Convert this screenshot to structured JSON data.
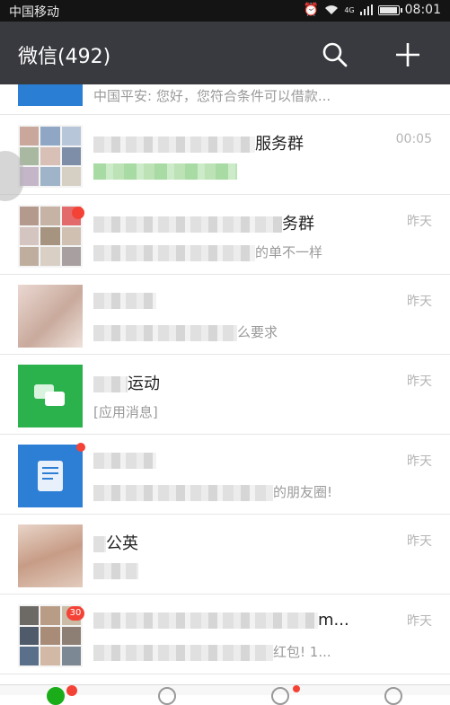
{
  "status_bar": {
    "carrier": "中国移动",
    "network": "4G",
    "time": "08:01"
  },
  "header": {
    "title": "微信(492)"
  },
  "partial_item": {
    "preview": "中国平安: 您好，您符合条件可以借款..."
  },
  "chats": [
    {
      "name_visible": "服务群",
      "preview_visible": "",
      "time": "00:05"
    },
    {
      "name_visible": "务群",
      "preview_visible": "的单不一样",
      "time": "昨天"
    },
    {
      "name_visible": "",
      "preview_visible": "么要求",
      "time": "昨天"
    },
    {
      "name_visible": "运动",
      "preview_visible": "[应用消息]",
      "time": "昨天"
    },
    {
      "name_visible": "",
      "preview_visible": "的朋友圈!",
      "time": "昨天"
    },
    {
      "name_visible": "公英",
      "preview_visible": "",
      "time": "昨天"
    },
    {
      "name_visible": "m...",
      "preview_visible": "红包! 1...",
      "time": "昨天",
      "badge": "30"
    }
  ],
  "colors": {
    "header_bg": "#393a3f",
    "status_bg": "#141414",
    "wechat_green": "#1aad19",
    "badge_red": "#f44336"
  }
}
